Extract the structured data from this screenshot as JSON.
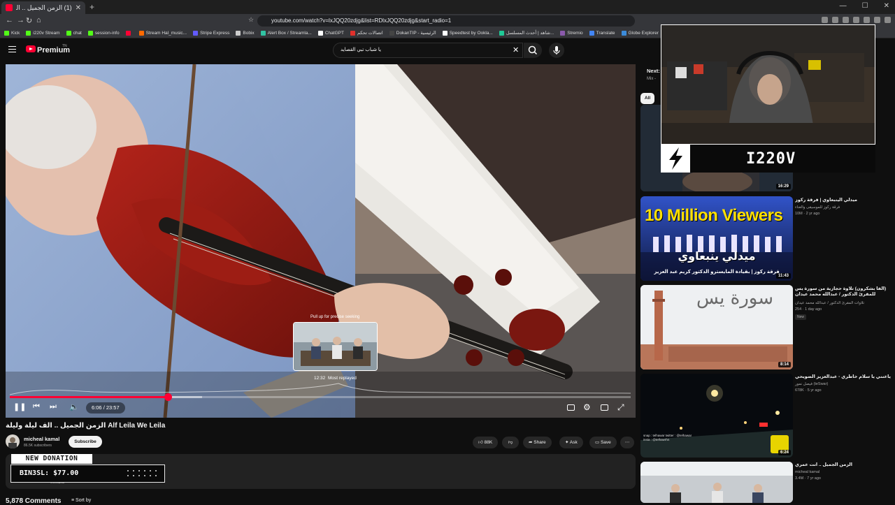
{
  "browser": {
    "tab_title": "(1) الزمن الجميل .. الف ليلة وليلة",
    "url": "youtube.com/watch?v=lxJQQ20zdjg&list=RDlxJQQ20zdjg&start_radio=1",
    "bookmarks": [
      {
        "label": "Kick",
        "color": "#53fc18"
      },
      {
        "label": "i220v Stream",
        "color": "#53fc18"
      },
      {
        "label": "chat",
        "color": "#53fc18"
      },
      {
        "label": "session-info",
        "color": "#53fc18"
      },
      {
        "label": "",
        "color": "#ff0033"
      },
      {
        "label": "Stream Hal_music...",
        "color": "#ff6a00"
      },
      {
        "label": "Stripe Express",
        "color": "#635bff"
      },
      {
        "label": "Bobix",
        "color": "#cccccc"
      },
      {
        "label": "Alert Box / Streamla...",
        "color": "#31c3a2"
      },
      {
        "label": "ChatGPT",
        "color": "#ffffff"
      },
      {
        "label": "اتصالات تحكم",
        "color": "#e0302c"
      },
      {
        "label": "DokanTIP - الرئيسية",
        "color": "#444444"
      },
      {
        "label": "Speedtest by Ookla...",
        "color": "#ffffff"
      },
      {
        "label": "شاهد | أحدث المسلسل...",
        "color": "#20c997"
      },
      {
        "label": "Stremio",
        "color": "#8a5aab"
      },
      {
        "label": "Translate",
        "color": "#4285f4"
      },
      {
        "label": "Globe Explorer",
        "color": "#3c8bd9"
      },
      {
        "label": "monday.com - SE...",
        "color": "#ff3d57"
      }
    ]
  },
  "header": {
    "brand": "Premium",
    "country": "TN",
    "search_value": "يا شباب تبي القصايد"
  },
  "player": {
    "current_time": "6:06",
    "duration": "23:57",
    "time_display": "6:06 / 23:57",
    "progress": 0.2547,
    "buffered": 0.31,
    "seek_hint": "Pull up for precise seeking",
    "preview_time": "12:32",
    "preview_label": "Most replayed"
  },
  "video": {
    "title": "الزمن الجميل .. الف ليلة وليلة Alf Leila We Leila",
    "channel": "micheal kamal",
    "subscribers": "86.5K subscribers",
    "subscribe_label": "Subscribe",
    "likes": "88K",
    "share_label": "Share",
    "ask_label": "Ask",
    "save_label": "Save",
    "desc_more": "...more",
    "comments_count": "5,878 Comments",
    "sort_label": "Sort by"
  },
  "donation": {
    "header": "NEW DONATION",
    "text": "BIN3SL: $77.00"
  },
  "sidebar": {
    "next_label": "Next: ",
    "mix_label": "Mix - ",
    "chip_all": "All",
    "items": [
      {
        "duration": "16:29",
        "title": "",
        "channel": "",
        "meta": "",
        "badge": ""
      },
      {
        "duration": "11:43",
        "title": "ميدلي اليتبعاوي | فرقة ركوز",
        "channel": "فرقة ركوز للموسيقى والغناء",
        "meta": "10M · 2 yr ago",
        "badge": "",
        "thumb_text_1": "10 Million Viewers",
        "thumb_text_2": "ميدلي ينبعاوي",
        "thumb_text_3": "فرقة ركوز | بقيادة المايسترو الدكتور كريم عبد العزيز"
      },
      {
        "duration": "8:14",
        "title": "(الفا بشكرون) تلاوة حجازية من سورة يس للمقرئ الدكتور / عبدالله محمد عيدان",
        "channel": "تلاوات المقرئ الدكتور / عبدالله محمد عيدان",
        "meta": "254 · 1 day ago",
        "badge": "New",
        "thumb_text_1": "سورة يس"
      },
      {
        "duration": "6:24",
        "title": "ياعنني يا سلام خاطري - عبدالعزيز الضويحي",
        "channel": "فيصل نمور (teSwar)",
        "meta": "678K · 5 yr ago",
        "badge": "",
        "thumb_text_1": "snap : telhawar  twitter : @telhawar  insta : @telhawrhn"
      },
      {
        "duration": "",
        "title": "الزمن الجميل .. انت عمري",
        "channel": "micheal kamal",
        "meta": "3.4M · 7 yr ago",
        "badge": ""
      }
    ]
  },
  "overlay": {
    "streamer_name": "I220V"
  },
  "colors": {
    "accent": "#ff0033",
    "background": "#0f0f0f"
  }
}
